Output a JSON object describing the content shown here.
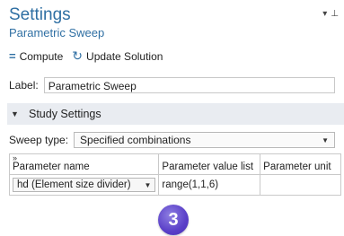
{
  "header": {
    "title": "Settings",
    "subtitle": "Parametric Sweep"
  },
  "toolbar": {
    "compute_label": "Compute",
    "update_label": "Update Solution"
  },
  "label_field": {
    "label": "Label:",
    "value": "Parametric Sweep"
  },
  "section": {
    "title": "Study Settings"
  },
  "sweep": {
    "label": "Sweep type:",
    "selected": "Specified combinations"
  },
  "table": {
    "headers": [
      "Parameter name",
      "Parameter value list",
      "Parameter unit"
    ],
    "rows": [
      {
        "name": "hd (Element size divider)",
        "values": "range(1,1,6)",
        "unit": ""
      }
    ]
  },
  "step_badge": "3"
}
